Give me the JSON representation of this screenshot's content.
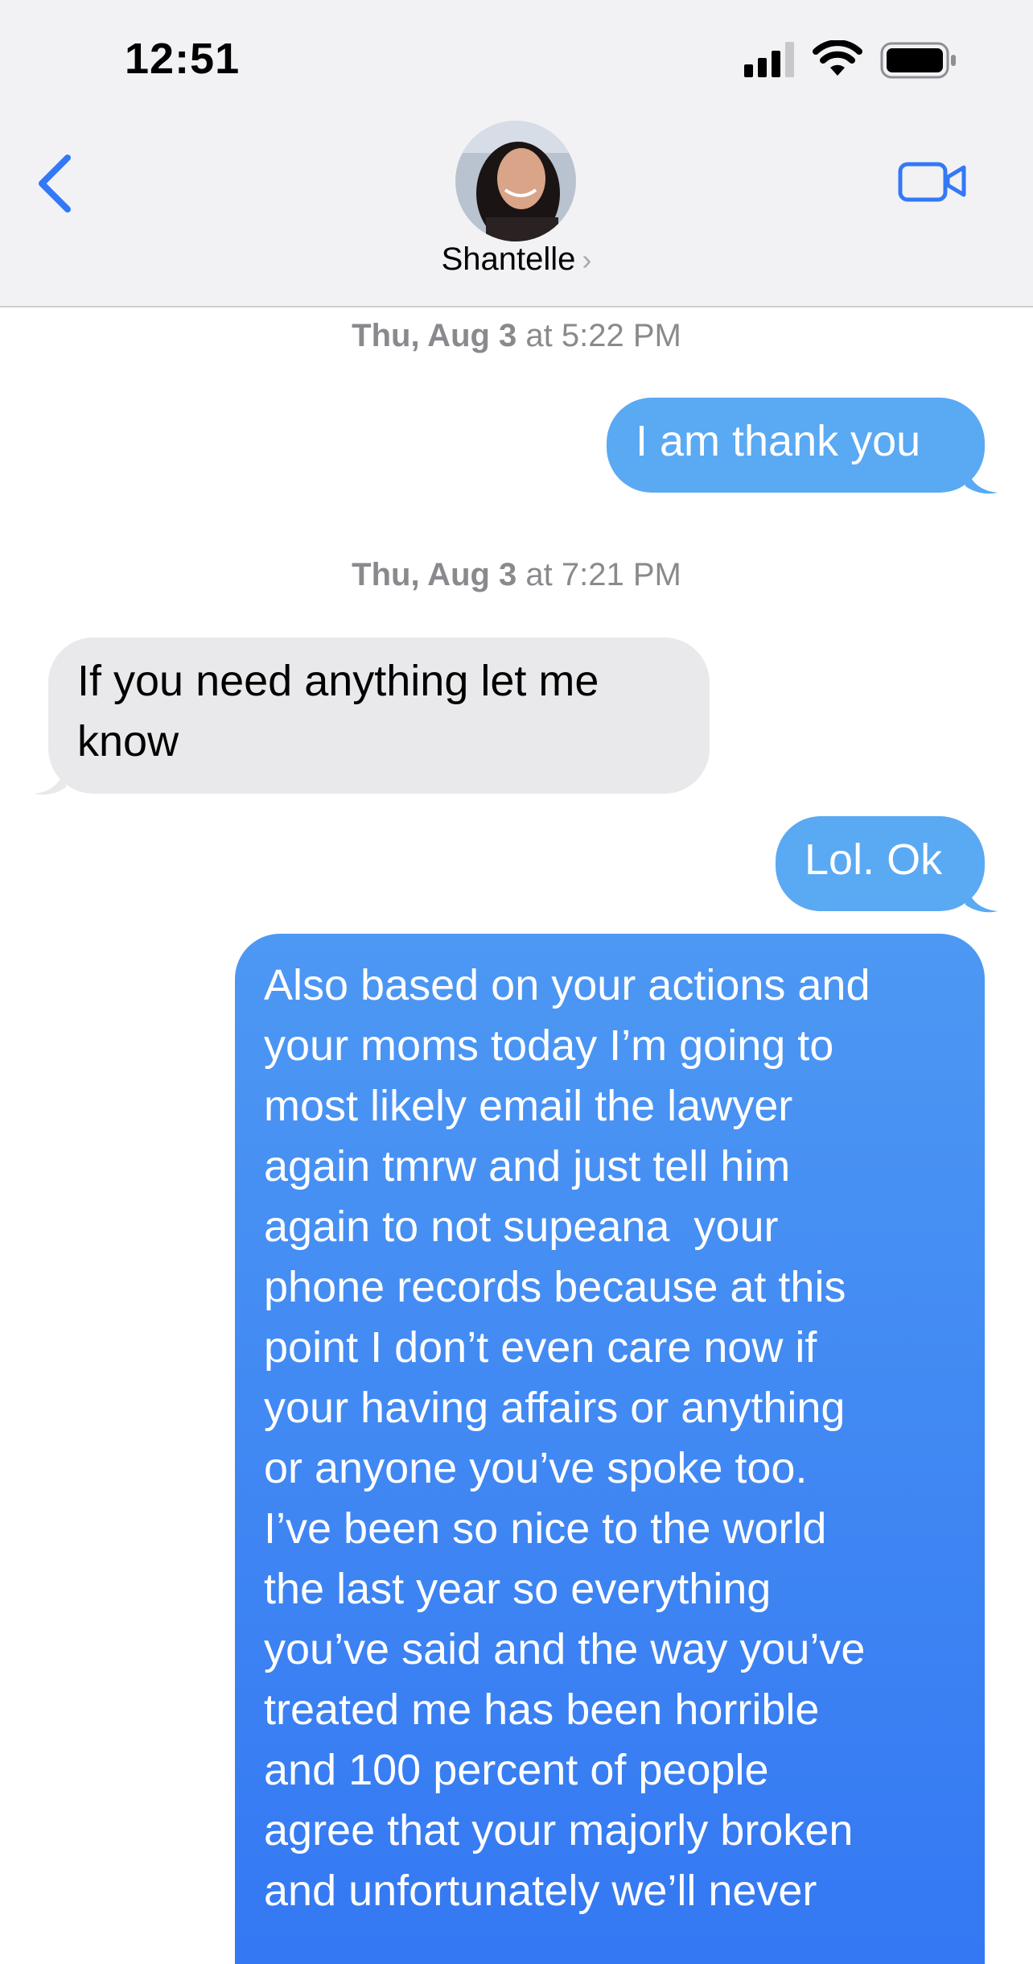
{
  "status_bar": {
    "time": "12:51"
  },
  "header": {
    "contact_name": "Shantelle",
    "chevron": "›",
    "icons": [
      "back-chevron-icon",
      "video-camera-icon",
      "avatar-photo"
    ]
  },
  "conversation": {
    "timestamps": [
      {
        "day": "Thu, Aug 3",
        "time": "at 5:22 PM"
      },
      {
        "day": "Thu, Aug 3",
        "time": "at 7:21 PM"
      }
    ],
    "messages": [
      {
        "direction": "outgoing",
        "text": "I am thank you"
      },
      {
        "direction": "incoming",
        "lines": [
          "If you need anything let me",
          "know"
        ]
      },
      {
        "direction": "outgoing",
        "text": "Lol. Ok"
      },
      {
        "direction": "outgoing",
        "lines": [
          "Also based on your actions and",
          "your moms today I’m going to",
          "most likely email the lawyer",
          "again tmrw and just tell him",
          "again to not supeana  your",
          "phone records because at this",
          "point I don’t even care now if",
          "your having affairs or anything",
          "or anyone you’ve spoke too.",
          "I’ve been so nice to the world",
          "the last year so everything",
          "you’ve said and the way you’ve",
          "treated me has been horrible",
          "and 100 percent of people",
          "agree that your majorly broken",
          "and unfortunately we’ll never"
        ]
      }
    ]
  },
  "colors": {
    "outgoing_bubble": "#5aa9f3",
    "outgoing_gradient_top": "#4d98f3",
    "outgoing_gradient_bottom": "#3478f3",
    "incoming_bubble": "#e9e9eb",
    "accent": "#3478f6",
    "timestamp_text": "#8a8a8e"
  }
}
